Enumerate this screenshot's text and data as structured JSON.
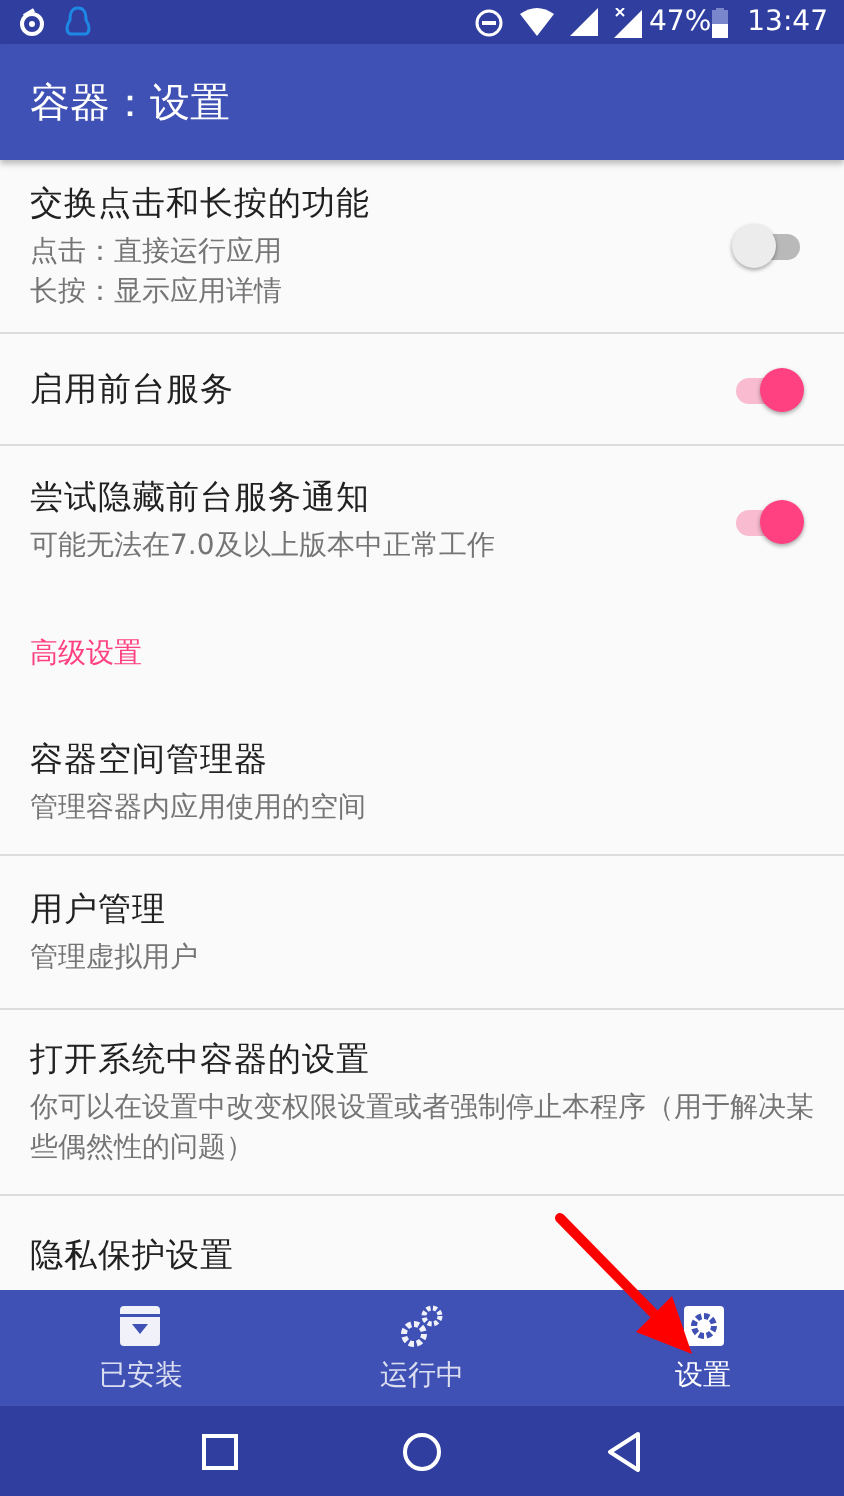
{
  "status_bar": {
    "battery": "47%",
    "time": "13:47"
  },
  "app_bar": {
    "title": "容器：设置"
  },
  "settings": [
    {
      "kind": "switch",
      "title": "交换点击和长按的功能",
      "summary_lines": [
        "点击：直接运行应用",
        "长按：显示应用详情"
      ],
      "on": false
    },
    {
      "kind": "switch",
      "title": "启用前台服务",
      "on": true
    },
    {
      "kind": "switch",
      "title": "尝试隐藏前台服务通知",
      "summary": "可能无法在7.0及以上版本中正常工作",
      "on": true
    },
    {
      "kind": "header",
      "title": "高级设置"
    },
    {
      "kind": "text",
      "title": "容器空间管理器",
      "summary": "管理容器内应用使用的空间"
    },
    {
      "kind": "text",
      "title": "用户管理",
      "summary": "管理虚拟用户"
    },
    {
      "kind": "text",
      "title": "打开系统中容器的设置",
      "summary": "你可以在设置中改变权限设置或者强制停止本程序（用于解决某些偶然性的问题）"
    },
    {
      "kind": "text",
      "title": "隐私保护设置"
    }
  ],
  "bottom_nav": [
    {
      "label": "已安装",
      "selected": false
    },
    {
      "label": "运行中",
      "selected": false
    },
    {
      "label": "设置",
      "selected": true
    }
  ]
}
